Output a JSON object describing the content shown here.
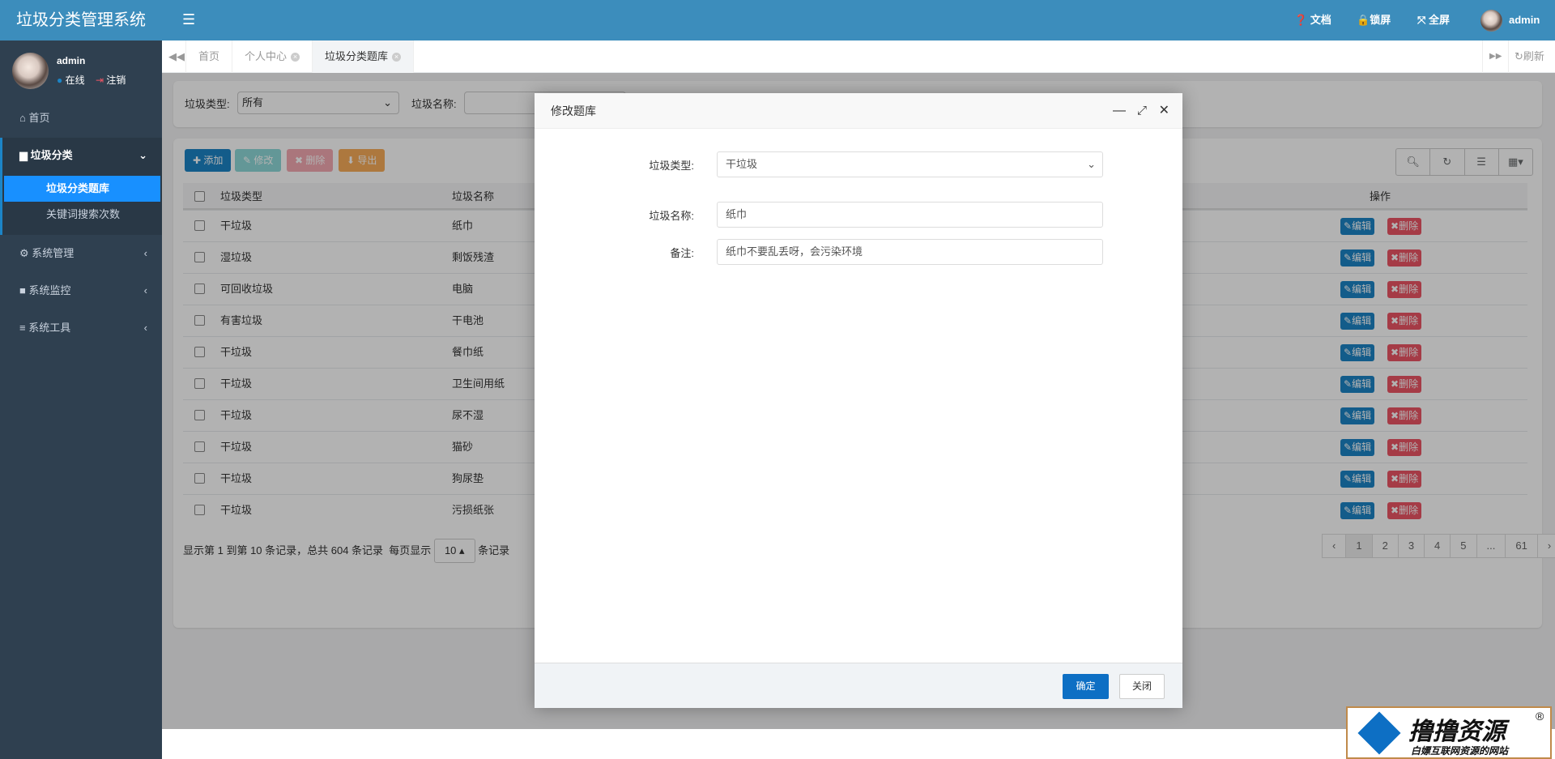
{
  "app": {
    "title": "垃圾分类管理系统"
  },
  "header": {
    "docs": "文档",
    "lock": "锁屏",
    "fullscreen": "全屏",
    "user": "admin"
  },
  "sidebar": {
    "user": "admin",
    "status": "在线",
    "logout": "注销",
    "items": [
      {
        "label": "首页",
        "icon": "home-icon"
      },
      {
        "label": "垃圾分类",
        "icon": "trash-icon",
        "expanded": true,
        "children": [
          {
            "label": "垃圾分类题库",
            "active": true
          },
          {
            "label": "关键词搜索次数"
          }
        ]
      },
      {
        "label": "系统管理",
        "icon": "gear-icon"
      },
      {
        "label": "系统监控",
        "icon": "video-icon"
      },
      {
        "label": "系统工具",
        "icon": "bars-icon"
      }
    ]
  },
  "tabs": {
    "items": [
      "首页",
      "个人中心",
      "垃圾分类题库"
    ],
    "refresh": "刷新"
  },
  "search": {
    "type_label": "垃圾类型:",
    "type_value": "所有",
    "name_label": "垃圾名称:"
  },
  "toolbar": {
    "add": "添加",
    "edit": "修改",
    "delete": "删除",
    "export": "导出"
  },
  "table": {
    "headers": [
      "垃圾类型",
      "垃圾名称",
      "操作"
    ],
    "edit": "编辑",
    "delete": "删除",
    "rows": [
      [
        "干垃圾",
        "纸巾"
      ],
      [
        "湿垃圾",
        "剩饭残渣"
      ],
      [
        "可回收垃圾",
        "电脑"
      ],
      [
        "有害垃圾",
        "干电池"
      ],
      [
        "干垃圾",
        "餐巾纸"
      ],
      [
        "干垃圾",
        "卫生间用纸"
      ],
      [
        "干垃圾",
        "尿不湿"
      ],
      [
        "干垃圾",
        "猫砂"
      ],
      [
        "干垃圾",
        "狗尿垫"
      ],
      [
        "干垃圾",
        "污损纸张"
      ]
    ]
  },
  "pagination": {
    "info": "显示第 1 到第 10 条记录，总共 604 条记录",
    "per_page_prefix": "每页显示",
    "per_page": "10",
    "per_page_suffix": "条记录",
    "pages": [
      "‹",
      "1",
      "2",
      "3",
      "4",
      "5",
      "...",
      "61",
      "›"
    ],
    "current": "1"
  },
  "modal": {
    "title": "修改题库",
    "type_label": "垃圾类型:",
    "type_value": "干垃圾",
    "name_label": "垃圾名称:",
    "name_value": "纸巾",
    "note_label": "备注:",
    "note_value": "纸巾不要乱丢呀，会污染环境",
    "ok": "确定",
    "close": "关闭"
  },
  "watermark": {
    "text": "撸撸资源",
    "sub": "白嫖互联网资源的网站"
  },
  "colors": {
    "header": "#3c8dbc",
    "sidebar": "#2f4050",
    "active": "#1890ff",
    "primary": "#1c84c6",
    "danger": "#ed5565",
    "warning": "#f8ac59",
    "info": "#23c6c8"
  }
}
